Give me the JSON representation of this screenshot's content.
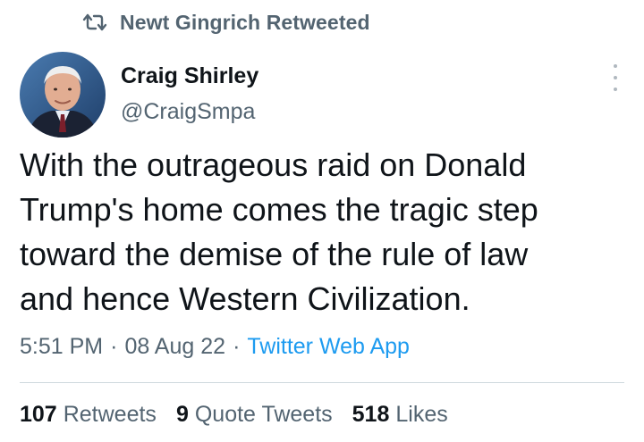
{
  "retweet": {
    "icon": "retweet-icon",
    "text": "Newt Gingrich Retweeted"
  },
  "author": {
    "avatar_icon": "avatar",
    "name": "Craig Shirley",
    "handle": "@CraigSmpa"
  },
  "tweet": {
    "text": "With the outrageous raid on Donald\nTrump's home comes the tragic step\ntoward the demise of the rule of law\nand hence Western Civilization."
  },
  "meta": {
    "time": "5:51 PM",
    "separator": "·",
    "date": "08 Aug 22",
    "source": "Twitter Web App"
  },
  "stats": {
    "retweets_count": "107",
    "retweets_label": "Retweets",
    "quotes_count": "9",
    "quotes_label": "Quote Tweets",
    "likes_count": "518",
    "likes_label": "Likes"
  },
  "colors": {
    "text_primary": "#0f1419",
    "text_secondary": "#536471",
    "link": "#1d9bf0",
    "divider": "#cfd9de"
  }
}
